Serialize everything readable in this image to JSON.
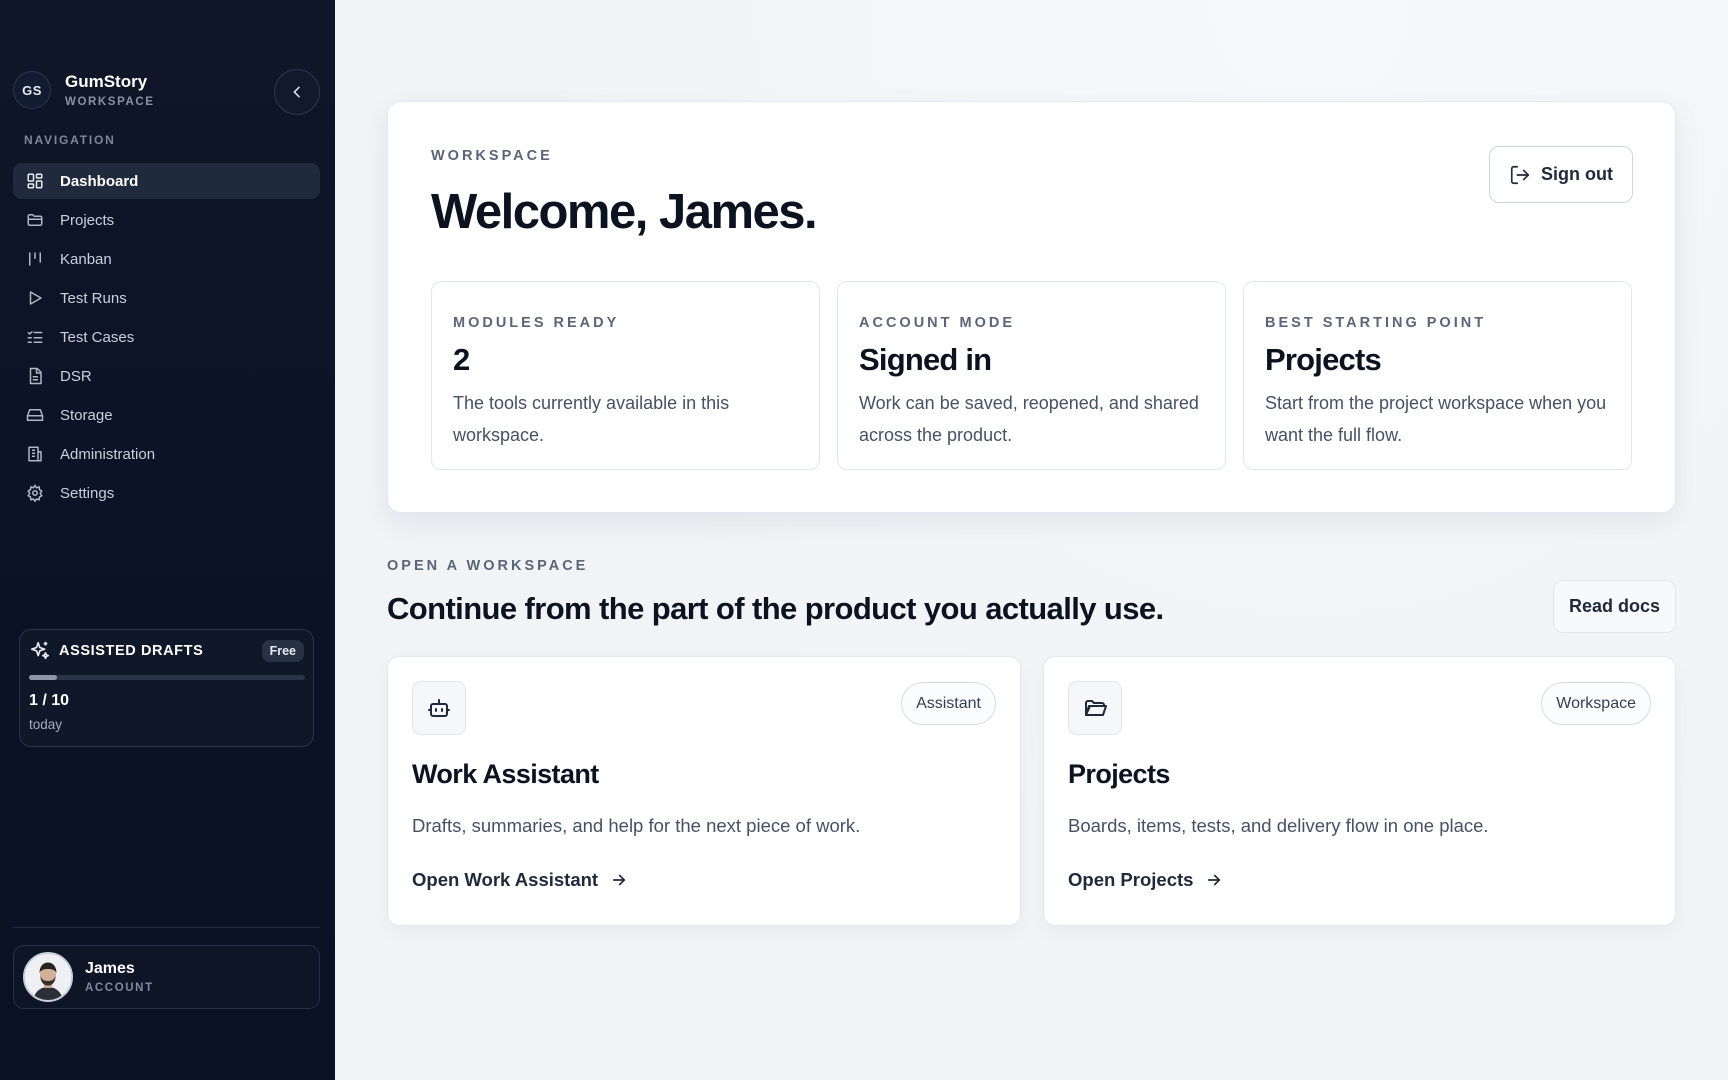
{
  "brand": {
    "initials": "GS",
    "name": "GumStory",
    "subtitle": "WORKSPACE"
  },
  "sidebar": {
    "nav_title": "NAVIGATION",
    "items": [
      {
        "label": "Dashboard",
        "icon": "dashboard-icon",
        "active": true
      },
      {
        "label": "Projects",
        "icon": "folder-icon"
      },
      {
        "label": "Kanban",
        "icon": "kanban-icon"
      },
      {
        "label": "Test Runs",
        "icon": "play-icon"
      },
      {
        "label": "Test Cases",
        "icon": "checklist-icon"
      },
      {
        "label": "DSR",
        "icon": "document-icon"
      },
      {
        "label": "Storage",
        "icon": "hard-drive-icon"
      },
      {
        "label": "Administration",
        "icon": "building-icon"
      },
      {
        "label": "Settings",
        "icon": "gear-icon"
      }
    ],
    "drafts": {
      "title": "ASSISTED DRAFTS",
      "badge": "Free",
      "count": "1 / 10",
      "period": "today",
      "progress": 0.1
    },
    "account": {
      "name": "James",
      "role": "ACCOUNT"
    }
  },
  "hero": {
    "eyebrow": "WORKSPACE",
    "title": "Welcome, James.",
    "signout_label": "Sign out",
    "stats": [
      {
        "label": "MODULES READY",
        "value": "2",
        "desc": "The tools currently available in this workspace."
      },
      {
        "label": "ACCOUNT MODE",
        "value": "Signed in",
        "desc": "Work can be saved, reopened, and shared across the product."
      },
      {
        "label": "BEST STARTING POINT",
        "value": "Projects",
        "desc": "Start from the project workspace when you want the full flow."
      }
    ]
  },
  "section": {
    "eyebrow": "OPEN A WORKSPACE",
    "title": "Continue from the part of the product you actually use.",
    "readdocs_label": "Read docs"
  },
  "cards": [
    {
      "tag": "Assistant",
      "title": "Work Assistant",
      "desc": "Drafts, summaries, and help for the next piece of work.",
      "link": "Open Work Assistant",
      "icon": "bot-icon"
    },
    {
      "tag": "Workspace",
      "title": "Projects",
      "desc": "Boards, items, tests, and delivery flow in one place.",
      "link": "Open Projects",
      "icon": "folder-open-icon"
    }
  ],
  "colors": {
    "sidebar_bg": "#0b1326",
    "nav_active_bg": "#1f2a3d",
    "page_bg": "#f1f3f7",
    "card_bg": "#ffffff",
    "heading": "#0b1220"
  }
}
